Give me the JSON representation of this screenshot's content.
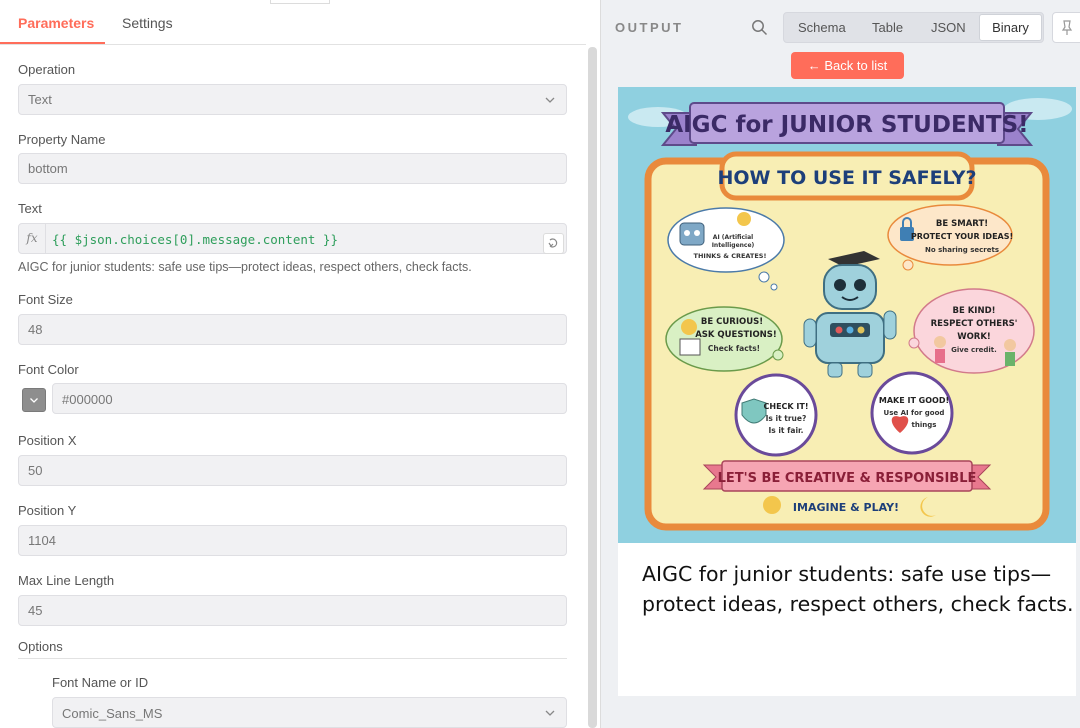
{
  "left": {
    "tabs": [
      {
        "label": "Parameters"
      },
      {
        "label": "Settings"
      }
    ],
    "operation": {
      "label": "Operation",
      "value": "Text"
    },
    "property_name": {
      "label": "Property Name",
      "value": "bottom"
    },
    "text": {
      "label": "Text",
      "fx": "fx",
      "expression": "{{ $json.choices[0].message.content }}",
      "preview": "AIGC for junior students: safe use tips—protect ideas, respect others, check facts."
    },
    "font_size": {
      "label": "Font Size",
      "value": "48"
    },
    "font_color": {
      "label": "Font Color",
      "value": "#000000"
    },
    "position_x": {
      "label": "Position X",
      "value": "50"
    },
    "position_y": {
      "label": "Position Y",
      "value": "1104"
    },
    "max_line_length": {
      "label": "Max Line Length",
      "value": "45"
    },
    "options": {
      "label": "Options",
      "font_name": {
        "label": "Font Name or ID",
        "value": "Comic_Sans_MS"
      }
    }
  },
  "right": {
    "title": "OUTPUT",
    "view_tabs": [
      "Schema",
      "Table",
      "JSON",
      "Binary"
    ],
    "active_view": "Binary",
    "back_label": "← Back to list",
    "poster": {
      "title": "AIGC for JUNIOR STUDENTS!",
      "subtitle": "HOW TO USE IT SAFELY?",
      "bubble_ai": [
        "AI (Artificial",
        "Intelligence)",
        "THINKS & CREATES!"
      ],
      "bubble_smart": [
        "BE SMART!",
        "PROTECT YOUR IDEAS!",
        "No sharing secrets"
      ],
      "bubble_curious": [
        "BE CURIOUS!",
        "ASK QUESTIONS!",
        "Check facts!"
      ],
      "bubble_kind": [
        "BE KIND!",
        "RESPECT OTHERS'",
        "WORK!",
        "Give credit."
      ],
      "circle_check": [
        "CHECK IT!",
        "Is it true?",
        "Is it fair."
      ],
      "circle_good": [
        "MAKE IT GOOD!",
        "Use AI for good",
        "things"
      ],
      "ribbon": "LET'S BE CREATIVE & RESPONSIBLE",
      "footer": "IMAGINE & PLAY!"
    },
    "caption": "AIGC for junior students: safe use tips—protect ideas, respect others, check facts."
  },
  "colors": {
    "accent": "#ff6d5a",
    "expression": "#2e9e5b",
    "poster_sky": "#8fd0e0",
    "poster_banner": "#b9a3de",
    "poster_frame": "#e98a3c",
    "poster_paper": "#f8eeb4"
  }
}
